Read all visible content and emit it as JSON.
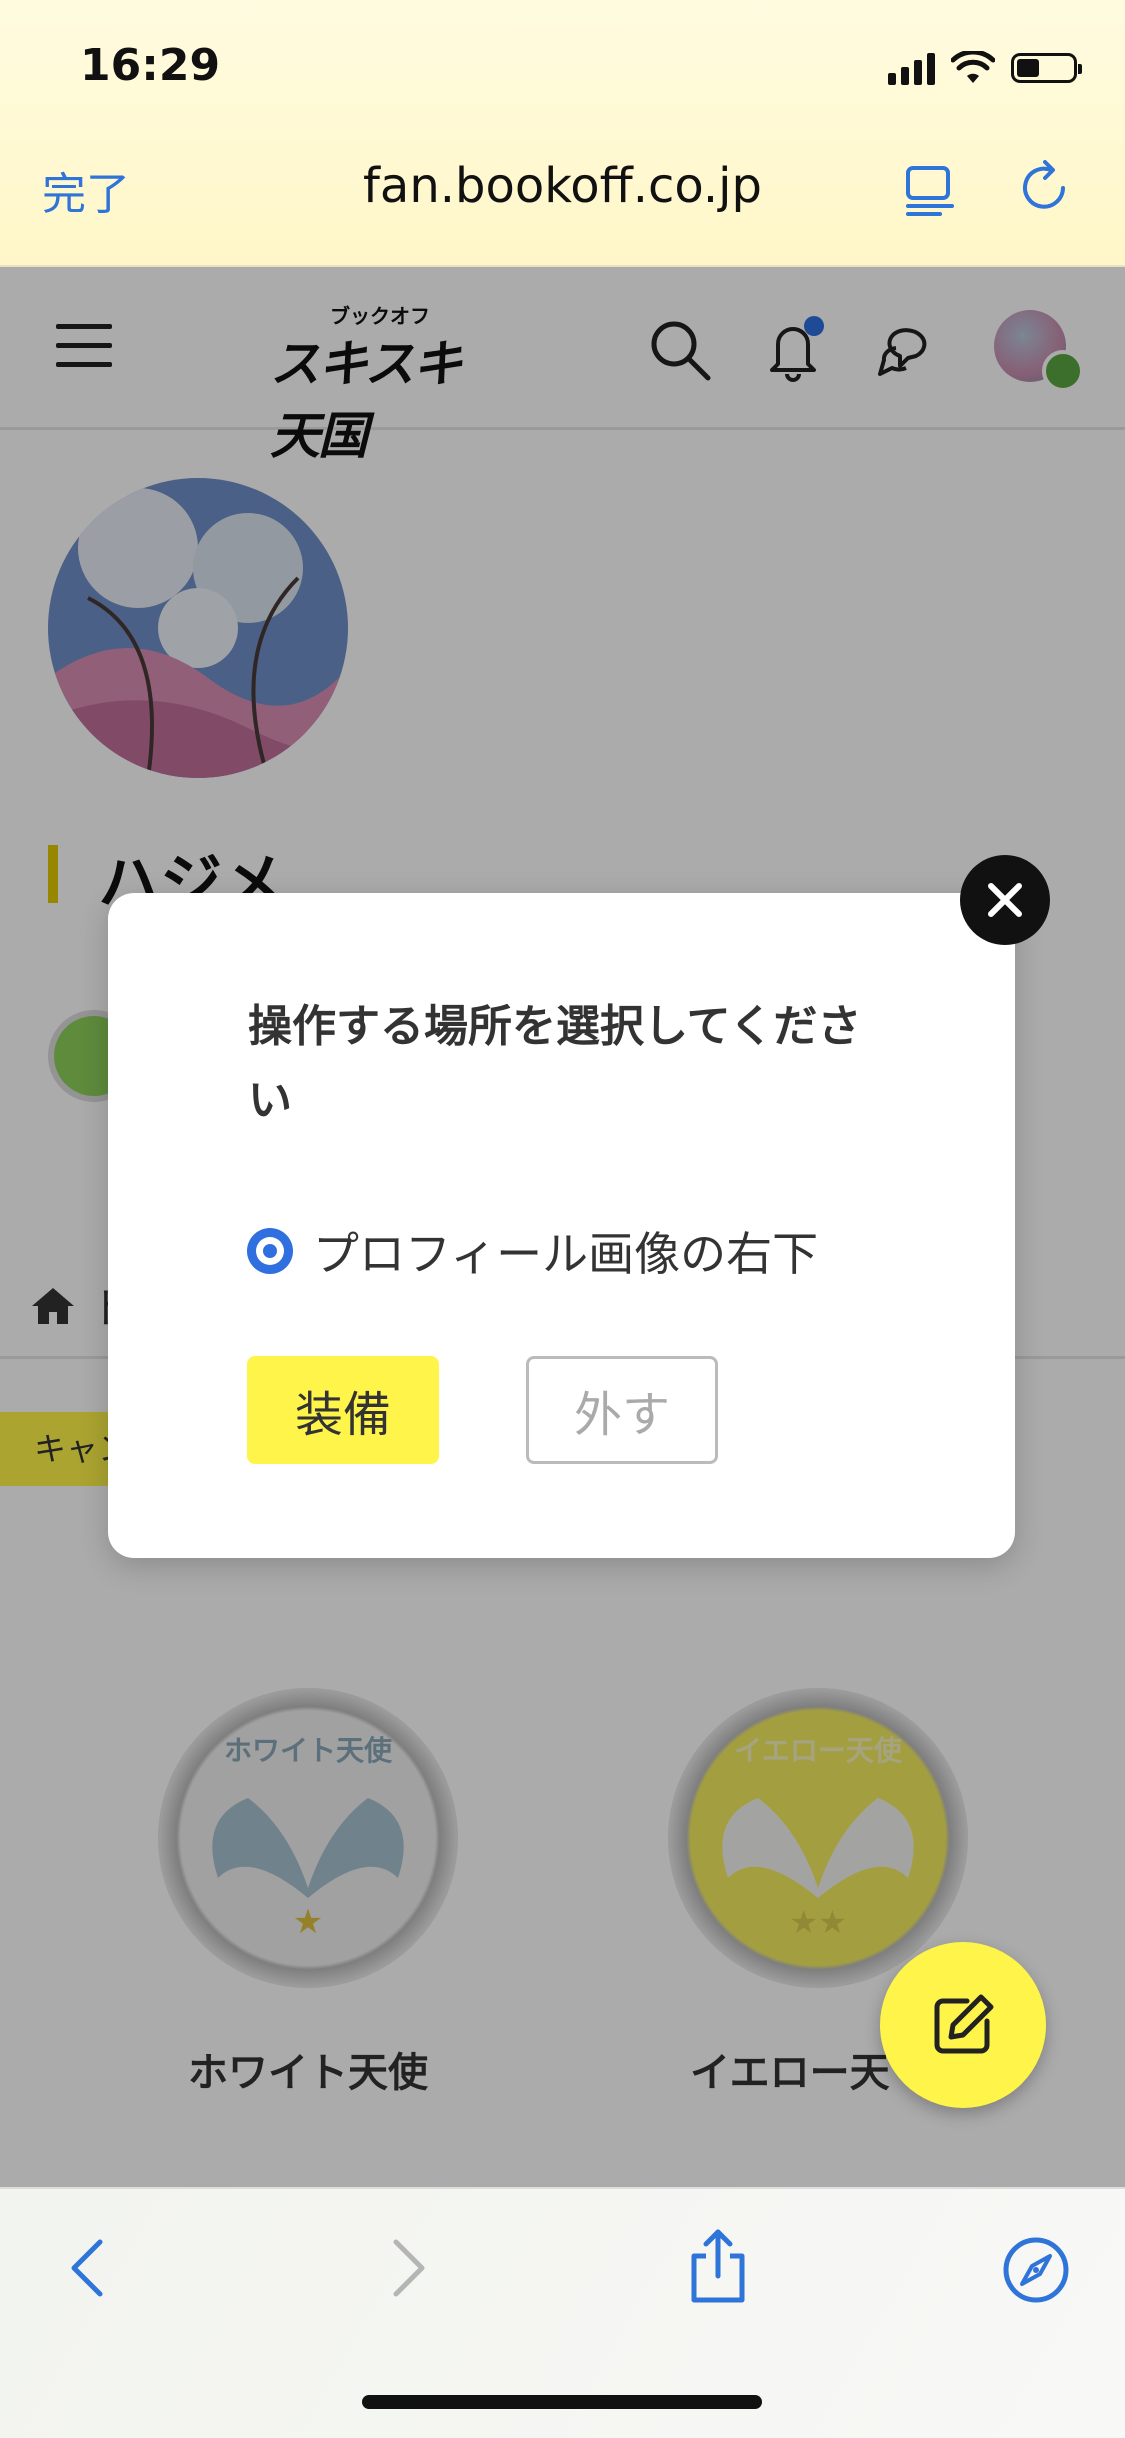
{
  "status_bar": {
    "time": "16:29",
    "icons": [
      "signal-icon",
      "wifi-icon",
      "battery-icon"
    ]
  },
  "browser": {
    "done_label": "完了",
    "url": "fan.bookoff.co.jp",
    "reader_icon": "reader-icon",
    "reload_icon": "reload-icon"
  },
  "site_header": {
    "menu_icon": "menu-icon",
    "logo_text": "スキスキ天国",
    "logo_small_text": "ブックオフ",
    "notification_dot": true
  },
  "profile": {
    "name": "ハジメ"
  },
  "sections": {
    "home_label": "ト",
    "cancel_label": "キャン"
  },
  "medals": [
    {
      "label": "ホワイト天使",
      "ring_text": "ホワイト天使",
      "stars": 1,
      "color": "#c9dce6"
    },
    {
      "label": "イエロー天",
      "ring_text": "イエロー天使",
      "stars": 2,
      "color": "#f4ee62"
    }
  ],
  "modal": {
    "title": "操作する場所を選択してください",
    "option_label": "プロフィール画像の右下",
    "option_selected": true,
    "equip_label": "装備",
    "remove_label": "外す"
  },
  "colors": {
    "accent_yellow": "#fff54a",
    "link_blue": "#2f74d9",
    "radio_blue": "#2f6fe0"
  }
}
